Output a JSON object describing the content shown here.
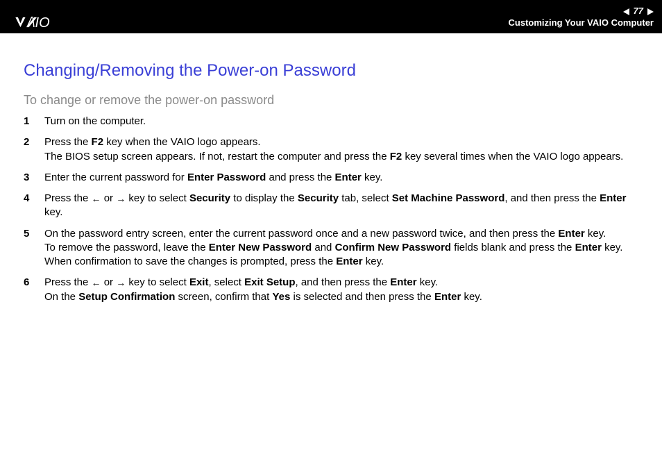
{
  "header": {
    "page_number": "77",
    "breadcrumb": "Customizing Your VAIO Computer"
  },
  "title": "Changing/Removing the Power-on Password",
  "subtitle": "To change or remove the power-on password",
  "steps": [
    {
      "num": "1",
      "html": "Turn on the computer."
    },
    {
      "num": "2",
      "html": "Press the <b>F2</b> key when the VAIO logo appears.<br>The BIOS setup screen appears. If not, restart the computer and press the <b>F2</b> key several times when the VAIO logo appears."
    },
    {
      "num": "3",
      "html": "Enter the current password for <b>Enter Password</b> and press the <b>Enter</b> key."
    },
    {
      "num": "4",
      "html": "Press the <span class='arrow'>&#8592;</span> or <span class='arrow'>&#8594;</span> key to select <b>Security</b> to display the <b>Security</b> tab, select <b>Set Machine Password</b>, and then press the <b>Enter</b> key."
    },
    {
      "num": "5",
      "html": "On the password entry screen, enter the current password once and a new password twice, and then press the <b>Enter</b> key.<br>To remove the password, leave the <b>Enter New Password</b> and <b>Confirm New Password</b> fields blank and press the <b>Enter</b> key.<br>When confirmation to save the changes is prompted, press the <b>Enter</b> key."
    },
    {
      "num": "6",
      "html": "Press the <span class='arrow'>&#8592;</span> or <span class='arrow'>&#8594;</span> key to select <b>Exit</b>, select <b>Exit Setup</b>, and then press the <b>Enter</b> key.<br>On the <b>Setup Confirmation</b> screen, confirm that <b>Yes</b> is selected and then press the <b>Enter</b> key."
    }
  ]
}
